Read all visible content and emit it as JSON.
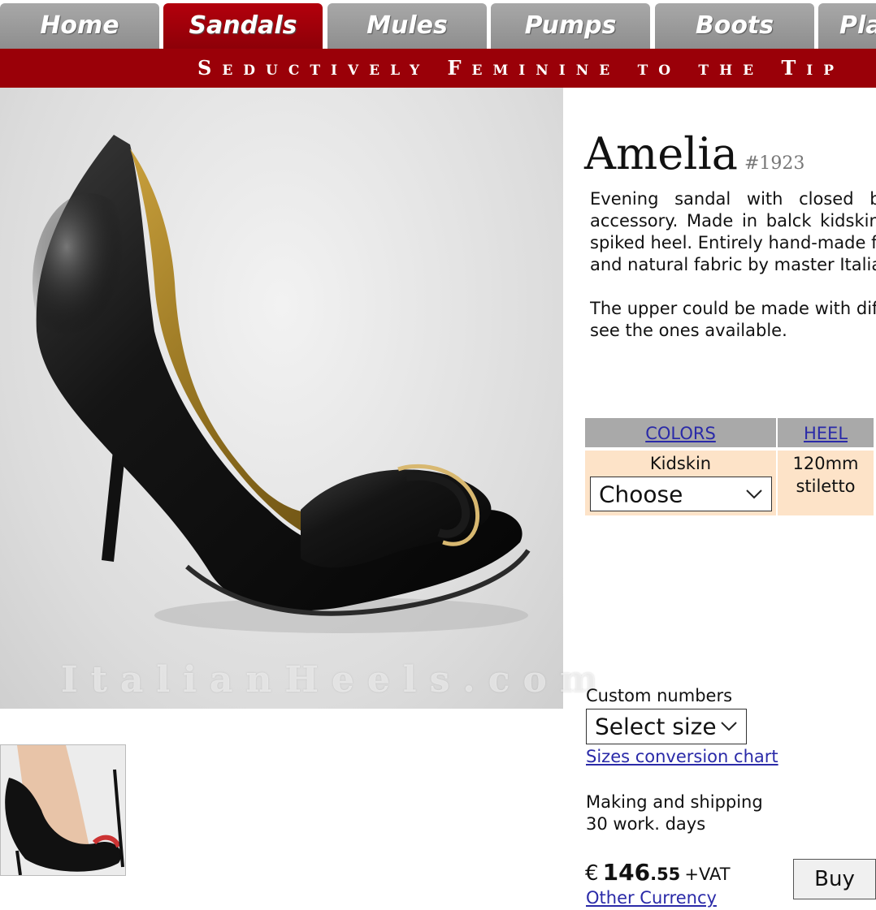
{
  "tabs": [
    {
      "label": "Home",
      "active": false
    },
    {
      "label": "Sandals",
      "active": true
    },
    {
      "label": "Mules",
      "active": false
    },
    {
      "label": "Pumps",
      "active": false
    },
    {
      "label": "Boots",
      "active": false
    },
    {
      "label": "Pla",
      "active": false
    }
  ],
  "tagline": "Seductively Feminine to the Tip",
  "watermark": "ItalianHeels.com",
  "product": {
    "name": "Amelia",
    "code": "#1923",
    "description_lines": [
      "Evening sandal with closed ba",
      "accessory. Made in balck kidskin",
      "spiked heel. Entirely hand-made fr",
      "and natural fabric by master Italiar"
    ],
    "note_lines": [
      "The upper could be made with dif",
      "see the ones available."
    ]
  },
  "options": {
    "colors_header": "COLORS",
    "heel_header": "HEEL",
    "material": "Kidskin",
    "color_select": "Choose",
    "heel_height": "120mm",
    "heel_type": "stiletto"
  },
  "size": {
    "label": "Custom numbers",
    "select": "Select size",
    "chart_link": "Sizes conversion chart"
  },
  "shipping": {
    "line1": "Making and shipping",
    "line2": "30 work. days"
  },
  "price": {
    "currency": "€",
    "integer": "146",
    "decimal": ".55",
    "vat": "+VAT",
    "other_currency": "Other Currency"
  },
  "buy_label": "Buy",
  "colors": {
    "tab_active": "#9a0008",
    "tab_inactive": "#9a9a9a",
    "tagline_bg": "#9a0008",
    "option_header_bg": "#a9a9a9",
    "option_cell_bg": "#fde3c8",
    "link": "#2a2aa8"
  }
}
